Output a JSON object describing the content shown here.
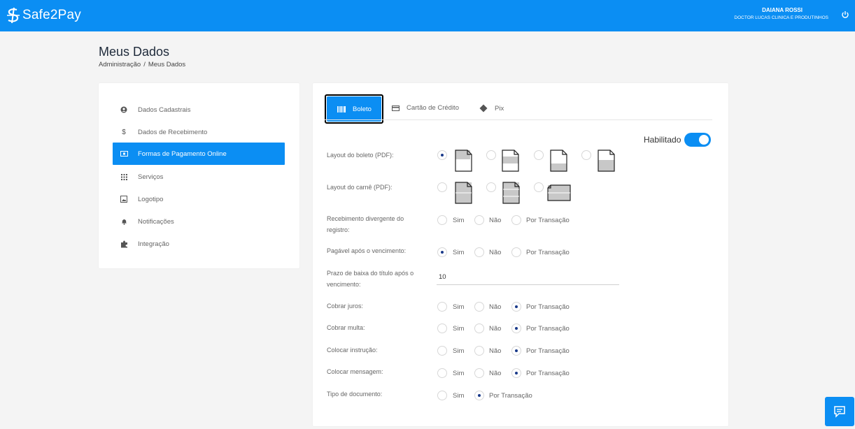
{
  "header": {
    "logo": "Safe2Pay",
    "user_name": "DAIANA ROSSI",
    "user_company": "DOCTOR LUCAS CLINICA E PRODUTINHOS",
    "power_icon": "power-icon",
    "brand_color": "#0b8ef3"
  },
  "page": {
    "title": "Meus Dados",
    "breadcrumb": [
      "Administração",
      "/",
      "Meus Dados"
    ]
  },
  "sidebar": {
    "items": [
      {
        "label": "Dados Cadastrais",
        "icon": "user-circle-icon"
      },
      {
        "label": "Dados de Recebimento",
        "icon": "dollar-icon"
      },
      {
        "label": "Formas de Pagamento Online",
        "icon": "money-bill-icon",
        "active": true
      },
      {
        "label": "Serviços",
        "icon": "grid-icon"
      },
      {
        "label": "Logotipo",
        "icon": "image-icon"
      },
      {
        "label": "Notificações",
        "icon": "bell-icon"
      },
      {
        "label": "Integração",
        "icon": "puzzle-icon"
      }
    ]
  },
  "tabs": [
    {
      "label": "Boleto",
      "icon": "barcode-icon",
      "active": true
    },
    {
      "label": "Cartão de Crédito",
      "icon": "credit-card-icon"
    },
    {
      "label": "Pix",
      "icon": "pix-icon"
    }
  ],
  "form": {
    "enabled_label": "Habilitado",
    "enabled": true,
    "boleto_layout_label": "Layout do boleto (PDF):",
    "carne_layout_label": "Layout do carnê (PDF):",
    "divergent_label": "Recebimento divergente do registro:",
    "after_due_label": "Pagável após o vencimento:",
    "deadline_label": "Prazo de baixa do título após o vencimento:",
    "deadline_value": "10",
    "interest_label": "Cobrar juros:",
    "fine_label": "Cobrar multa:",
    "instruction_label": "Colocar instrução:",
    "message_label": "Colocar mensagem:",
    "doc_type_label": "Tipo de documento:",
    "opt_sim": "Sim",
    "opt_nao": "Não",
    "opt_transacao": "Por Transação"
  },
  "chat_icon": "chat-icon"
}
